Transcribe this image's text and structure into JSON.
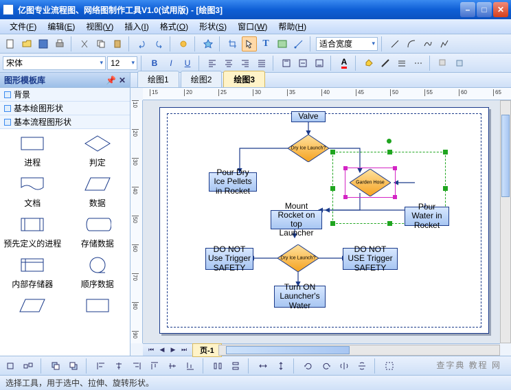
{
  "title": "亿图专业流程图、网络图制作工具V1.0(试用版) - [绘图3]",
  "menus": [
    {
      "label": "文件",
      "key": "F"
    },
    {
      "label": "编辑",
      "key": "E"
    },
    {
      "label": "视图",
      "key": "V"
    },
    {
      "label": "插入",
      "key": "I"
    },
    {
      "label": "格式",
      "key": "O"
    },
    {
      "label": "形状",
      "key": "S"
    },
    {
      "label": "窗口",
      "key": "W"
    },
    {
      "label": "帮助",
      "key": "H"
    }
  ],
  "toolbar": {
    "zoom_label": "适合宽度"
  },
  "format": {
    "font": "宋体",
    "size": "12",
    "bold": "B",
    "italic": "I",
    "underline": "U"
  },
  "sidebar": {
    "header": "图形模板库",
    "cats": [
      "背景",
      "基本绘图形状",
      "基本流程图形状"
    ],
    "shapes": [
      {
        "name": "进程",
        "type": "rect"
      },
      {
        "name": "判定",
        "type": "diamond"
      },
      {
        "name": "文档",
        "type": "doc"
      },
      {
        "name": "数据",
        "type": "para"
      },
      {
        "name": "预先定义的进程",
        "type": "predef"
      },
      {
        "name": "存储数据",
        "type": "storage"
      },
      {
        "name": "内部存储器",
        "type": "internal"
      },
      {
        "name": "顺序数据",
        "type": "circle"
      }
    ]
  },
  "tabs": [
    {
      "label": "绘图1",
      "active": false
    },
    {
      "label": "绘图2",
      "active": false
    },
    {
      "label": "绘图3",
      "active": true
    }
  ],
  "page_tab": "页-1",
  "ruler": {
    "h": [
      "15",
      "20",
      "25",
      "30",
      "35",
      "40",
      "45",
      "50",
      "55",
      "60",
      "65"
    ],
    "v": [
      "10",
      "20",
      "30",
      "40",
      "50",
      "60",
      "70",
      "80",
      "90"
    ]
  },
  "nodes": {
    "valve": "Valve",
    "dryice_launch": "Dry Ice Launch?",
    "pour_dryice": "Pour Dry Ice Pellets in Rocket",
    "garden_hose": "Garden Hose",
    "mount_rocket": "Mount Rocket on top Launcher",
    "pour_water": "Pour Water in Rocket",
    "donot1": "DO NOT Use Trigger SAFETY",
    "decision2": "Dry Ice Launch?",
    "donot2": "DO NOT USE Trigger SAFETY",
    "turnon": "Turn ON Launcher's Water"
  },
  "status_text": "选择工具，用于选中、拉伸、旋转形状。",
  "watermark": "查字典 教程 网"
}
